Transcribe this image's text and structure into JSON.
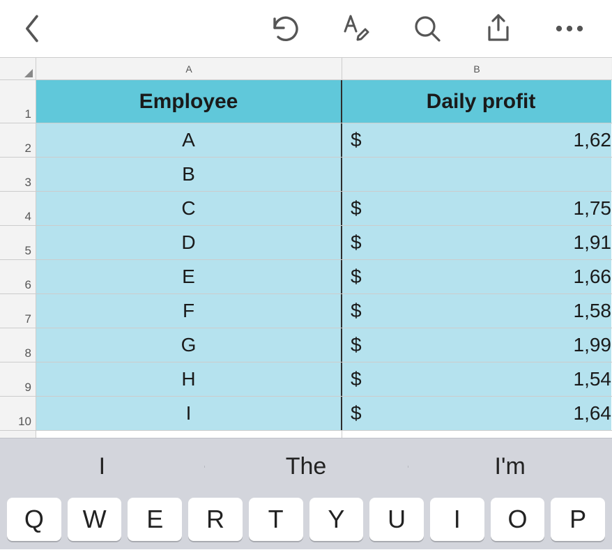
{
  "toolbar": {
    "icons": [
      "back",
      "undo",
      "edit-text",
      "search",
      "share",
      "more"
    ]
  },
  "columns": [
    "A",
    "B"
  ],
  "header": {
    "A": "Employee",
    "B": "Daily profit"
  },
  "rows": [
    {
      "n": "1"
    },
    {
      "n": "2",
      "emp": "A",
      "cur": "$",
      "val": "1,62"
    },
    {
      "n": "3",
      "emp": "B",
      "cur": "",
      "val": ""
    },
    {
      "n": "4",
      "emp": "C",
      "cur": "$",
      "val": "1,75"
    },
    {
      "n": "5",
      "emp": "D",
      "cur": "$",
      "val": "1,91"
    },
    {
      "n": "6",
      "emp": "E",
      "cur": "$",
      "val": "1,66"
    },
    {
      "n": "7",
      "emp": "F",
      "cur": "$",
      "val": "1,58"
    },
    {
      "n": "8",
      "emp": "G",
      "cur": "$",
      "val": "1,99"
    },
    {
      "n": "9",
      "emp": "H",
      "cur": "$",
      "val": "1,54"
    },
    {
      "n": "10",
      "emp": "I",
      "cur": "$",
      "val": "1,64"
    }
  ],
  "empty_row": {
    "n": ""
  },
  "suggestions": [
    "I",
    "The",
    "I'm"
  ],
  "keys": [
    "Q",
    "W",
    "E",
    "R",
    "T",
    "Y",
    "U",
    "I",
    "O",
    "P"
  ]
}
